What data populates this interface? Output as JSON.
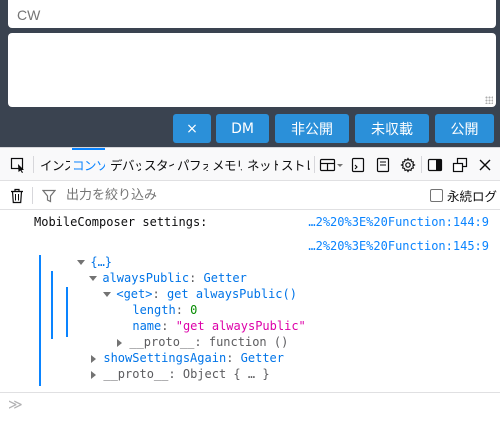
{
  "composer": {
    "cw_placeholder": "CW",
    "text_value": "",
    "buttons": {
      "close_label": "×",
      "dm_label": "DM",
      "private_label": "非公開",
      "unlisted_label": "未収載",
      "public_label": "公開"
    },
    "colors": {
      "panel_bg": "#3a4350",
      "button_bg": "#2b90d9"
    }
  },
  "devtools": {
    "toolbar": {
      "icons": [
        "element-picker-icon",
        "responsive-design-icon",
        "split-console-icon",
        "settings-icon",
        "dock-side-icon",
        "separate-window-icon",
        "close-icon"
      ],
      "tabs": [
        {
          "label": "インスペクター",
          "selected": false
        },
        {
          "label": "コンソール",
          "selected": true
        },
        {
          "label": "デバッガー",
          "selected": false
        },
        {
          "label": "スタイルエディター",
          "selected": false
        },
        {
          "label": "パフォーマンス",
          "selected": false
        },
        {
          "label": "メモリー",
          "selected": false
        },
        {
          "label": "ネットワーク",
          "selected": false
        },
        {
          "label": "ストレージ",
          "selected": false
        }
      ]
    },
    "filter": {
      "placeholder": "出力を絞り込み",
      "persist_logs_label": "永続ログ",
      "persist_logs_checked": false
    },
    "console": {
      "messages": [
        {
          "text": "MobileComposer settings:",
          "source": "…2%20%3E%20Function:144:9"
        },
        {
          "source": "…2%20%3E%20Function:145:9",
          "object_tree": {
            "root_label": "{…}",
            "rows": [
              {
                "key": "alwaysPublic",
                "sep": ": ",
                "value": "Getter"
              },
              {
                "key": "<get>",
                "sep": ": ",
                "value": "get alwaysPublic()"
              },
              {
                "key": "length",
                "sep": ": ",
                "value": "0"
              },
              {
                "key": "name",
                "sep": ": ",
                "value": "\"get alwaysPublic\""
              },
              {
                "key": "__proto__",
                "sep": ": ",
                "value": "function ()"
              },
              {
                "key": "showSettingsAgain",
                "sep": ": ",
                "value": "Getter"
              },
              {
                "key": "__proto__",
                "sep": ": ",
                "value": "Object { … }"
              }
            ]
          }
        }
      ],
      "command_prompt": "≫"
    }
  }
}
